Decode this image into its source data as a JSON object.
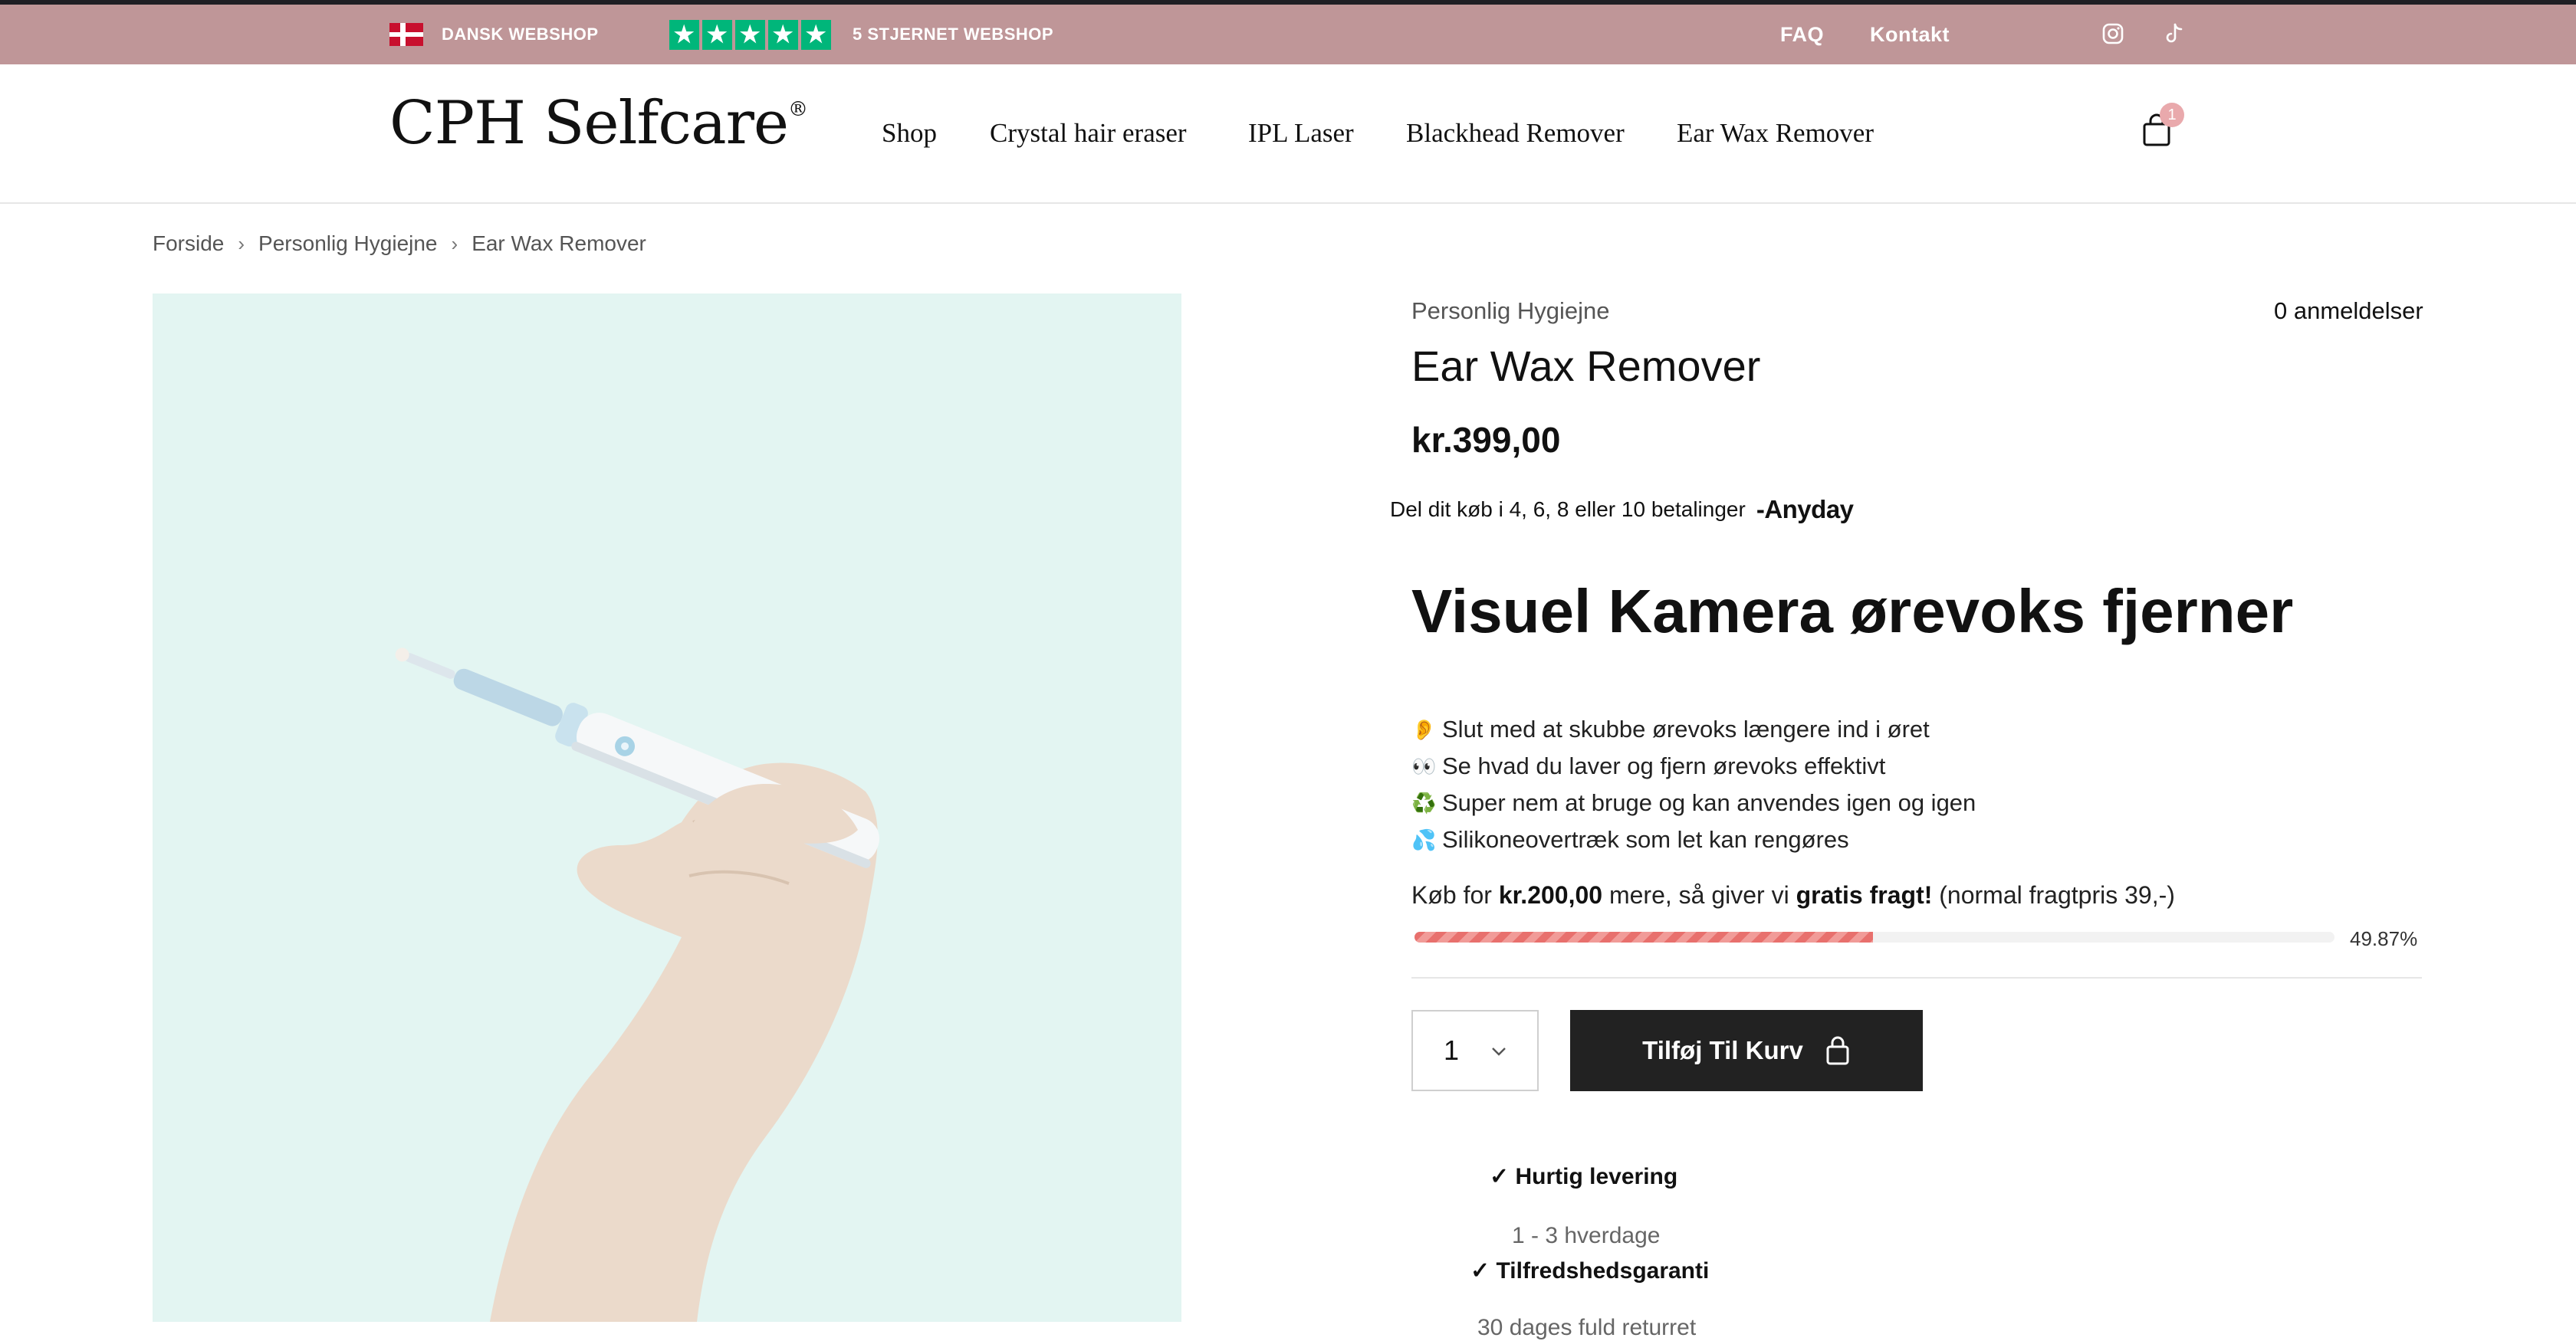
{
  "topbar": {
    "left_label": "DANSK WEBSHOP",
    "rating_label": "5 STJERNET WEBSHOP",
    "faq": "FAQ",
    "contact": "Kontakt"
  },
  "header": {
    "logo": "CPH Selfcare",
    "logo_mark": "®",
    "nav": [
      "Shop",
      "Crystal hair eraser",
      "IPL Laser",
      "Blackhead Remover",
      "Ear Wax Remover"
    ],
    "cart_count": "1"
  },
  "breadcrumb": [
    "Forside",
    "Personlig Hygiejne",
    "Ear Wax Remover"
  ],
  "product": {
    "category": "Personlig Hygiejne",
    "reviews": "0 anmeldelser",
    "title": "Ear Wax Remover",
    "price": "kr.399,00",
    "installments": "Del dit køb i 4, 6, 8 eller 10 betalinger",
    "installments_brand": "Anyday",
    "headline": "Visuel Kamera ørevoks fjerner",
    "features": [
      {
        "icon": "ear-icon",
        "emoji": "👂",
        "text": "Slut med at skubbe ørevoks længere ind i øret"
      },
      {
        "icon": "eyes-icon",
        "emoji": "👀",
        "text": "Se hvad du laver og fjern ørevoks effektivt"
      },
      {
        "icon": "recycle-icon",
        "emoji": "♻️",
        "text": "Super nem at bruge og kan anvendes igen og igen"
      },
      {
        "icon": "droplets-icon",
        "emoji": "💦",
        "text": "Silikoneovertræk som let kan rengøres"
      }
    ],
    "shipping": {
      "pre": "Køb for ",
      "amount": "kr.200,00",
      "mid": " mere, så giver vi ",
      "free": "gratis fragt!",
      "post": " (normal fragtpris 39,-)",
      "progress_percent": 49.87,
      "progress_label": "49.87%"
    },
    "quantity": "1",
    "add_to_cart": "Tilføj Til Kurv",
    "benefits": [
      {
        "title": "Hurtig levering",
        "sub": "1 - 3 hverdage"
      },
      {
        "title": "Tilfredshedsgaranti",
        "sub": "30 dages fuld returret"
      }
    ]
  },
  "colors": {
    "topbar": "#bf9698",
    "trustpilot_green": "#00b67a",
    "button": "#222222",
    "progress": "#e8706d",
    "image_bg": "#e3f5f2",
    "badge": "#e9a9ac"
  }
}
